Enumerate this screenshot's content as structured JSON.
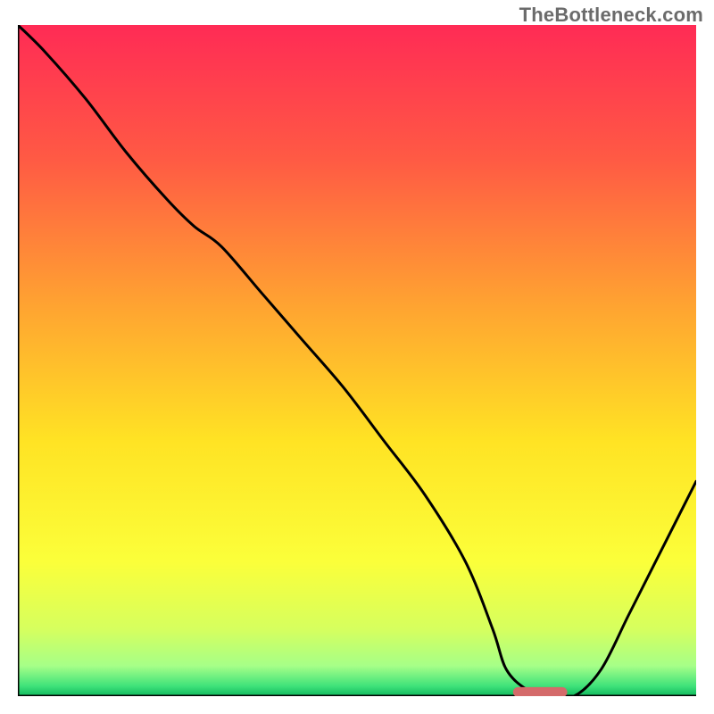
{
  "watermark": "TheBottleneck.com",
  "chart_data": {
    "type": "line",
    "title": "",
    "xlabel": "",
    "ylabel": "",
    "xlim": [
      0,
      100
    ],
    "ylim": [
      0,
      100
    ],
    "grid": false,
    "legend": false,
    "background_gradient_stops": [
      {
        "offset": 0.0,
        "color": "#ff2b55"
      },
      {
        "offset": 0.2,
        "color": "#ff5a44"
      },
      {
        "offset": 0.42,
        "color": "#ffa431"
      },
      {
        "offset": 0.62,
        "color": "#ffe324"
      },
      {
        "offset": 0.8,
        "color": "#fbff3a"
      },
      {
        "offset": 0.9,
        "color": "#d6ff5e"
      },
      {
        "offset": 0.955,
        "color": "#a6ff88"
      },
      {
        "offset": 0.985,
        "color": "#3fe27a"
      },
      {
        "offset": 1.0,
        "color": "#0fb85c"
      }
    ],
    "series": [
      {
        "name": "bottleneck-curve",
        "color": "#000000",
        "x": [
          0,
          4,
          10,
          16,
          22,
          26,
          30,
          36,
          42,
          48,
          54,
          60,
          66,
          70,
          72,
          75,
          78,
          82,
          86,
          90,
          94,
          98,
          100
        ],
        "y": [
          100,
          96,
          89,
          81,
          74,
          70,
          67,
          60,
          53,
          46,
          38,
          30,
          20,
          10,
          4,
          1,
          0,
          0,
          4,
          12,
          20,
          28,
          32
        ]
      }
    ],
    "markers": [
      {
        "name": "optimal-marker",
        "shape": "rounded-bar",
        "color": "#d46a6a",
        "x_center": 77,
        "y_center": 0.6,
        "width": 8,
        "height": 1.5
      }
    ],
    "axes": {
      "left": {
        "visible": true,
        "color": "#000000"
      },
      "bottom": {
        "visible": true,
        "color": "#000000"
      },
      "ticks": []
    }
  }
}
